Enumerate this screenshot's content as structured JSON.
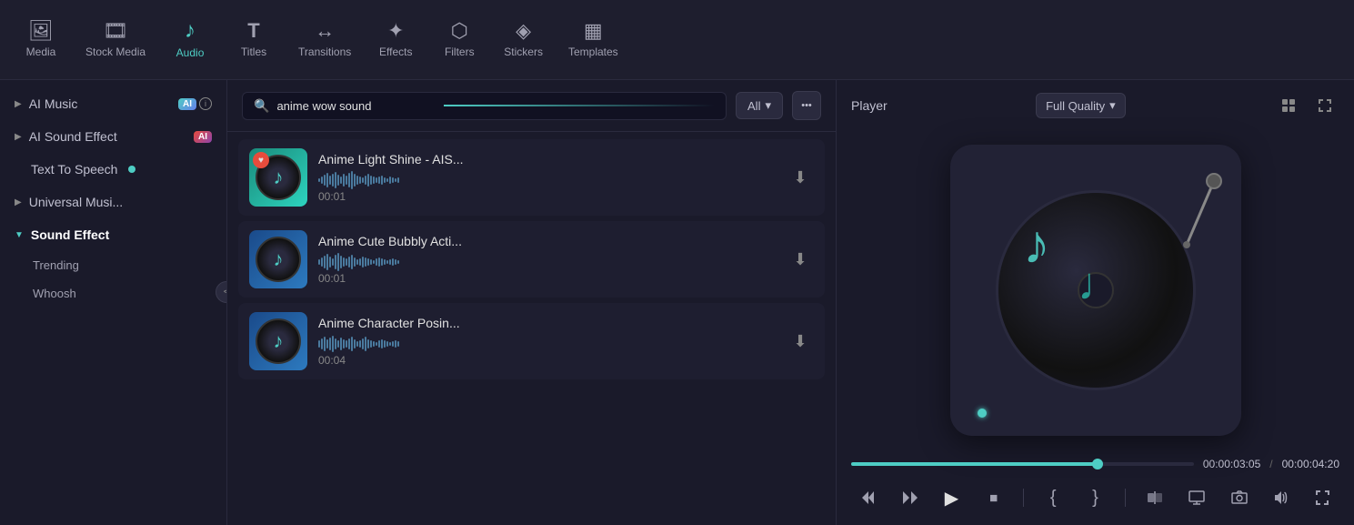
{
  "nav": {
    "items": [
      {
        "id": "media",
        "label": "Media",
        "icon": "🖼",
        "active": false
      },
      {
        "id": "stock-media",
        "label": "Stock Media",
        "icon": "🎞",
        "active": false
      },
      {
        "id": "audio",
        "label": "Audio",
        "icon": "♪",
        "active": true
      },
      {
        "id": "titles",
        "label": "Titles",
        "icon": "T",
        "active": false
      },
      {
        "id": "transitions",
        "label": "Transitions",
        "icon": "↔",
        "active": false
      },
      {
        "id": "effects",
        "label": "Effects",
        "icon": "✦",
        "active": false
      },
      {
        "id": "filters",
        "label": "Filters",
        "icon": "⬡",
        "active": false
      },
      {
        "id": "stickers",
        "label": "Stickers",
        "icon": "◈",
        "active": false
      },
      {
        "id": "templates",
        "label": "Templates",
        "icon": "▦",
        "active": false
      }
    ]
  },
  "sidebar": {
    "items": [
      {
        "id": "ai-music",
        "label": "AI Music",
        "type": "ai",
        "collapsed": true
      },
      {
        "id": "ai-sound-effect",
        "label": "AI Sound Effect",
        "type": "ai",
        "collapsed": true
      },
      {
        "id": "text-to-speech",
        "label": "Text To Speech",
        "type": "dot",
        "collapsed": false
      },
      {
        "id": "universal-music",
        "label": "Universal Musi...",
        "type": "arrow",
        "collapsed": true
      },
      {
        "id": "sound-effect",
        "label": "Sound Effect",
        "type": "expand",
        "collapsed": false
      }
    ],
    "sub_items": [
      {
        "id": "trending",
        "label": "Trending"
      },
      {
        "id": "whoosh",
        "label": "Whoosh"
      }
    ],
    "collapse_btn": "<"
  },
  "search": {
    "placeholder": "anime wow sound",
    "value": "anime wow sound",
    "filter_label": "All",
    "filter_icon": "▾",
    "more_icon": "•••"
  },
  "tracks": [
    {
      "id": "track-1",
      "title": "Anime Light Shine - AIS...",
      "duration": "00:01",
      "has_heart": true,
      "thumb_type": "green"
    },
    {
      "id": "track-2",
      "title": "Anime Cute Bubbly Acti...",
      "duration": "00:01",
      "has_heart": false,
      "thumb_type": "blue"
    },
    {
      "id": "track-3",
      "title": "Anime Character Posin...",
      "duration": "00:04",
      "has_heart": false,
      "thumb_type": "blue"
    }
  ],
  "player": {
    "label": "Player",
    "quality_label": "Full Quality",
    "time_current": "00:00:03:05",
    "time_separator": "/",
    "time_total": "00:00:04:20",
    "progress_percent": 72,
    "controls": [
      {
        "id": "rewind",
        "icon": "⏮",
        "label": "rewind"
      },
      {
        "id": "step-back",
        "icon": "⏭",
        "label": "step-back"
      },
      {
        "id": "play",
        "icon": "▶",
        "label": "play"
      },
      {
        "id": "stop",
        "icon": "⏹",
        "label": "stop"
      },
      {
        "id": "bracket-left",
        "icon": "[",
        "label": "bracket-left"
      },
      {
        "id": "bracket-right",
        "icon": "]",
        "label": "bracket-right"
      },
      {
        "id": "split",
        "icon": "⬕",
        "label": "split"
      },
      {
        "id": "monitor",
        "icon": "🖥",
        "label": "monitor"
      },
      {
        "id": "camera",
        "icon": "📷",
        "label": "camera"
      },
      {
        "id": "volume",
        "icon": "🔊",
        "label": "volume"
      },
      {
        "id": "fullscreen",
        "icon": "⛶",
        "label": "fullscreen"
      }
    ]
  },
  "colors": {
    "accent": "#4ecdc4",
    "bg_dark": "#1a1a2a",
    "bg_card": "#1e1e30",
    "border": "#2a2a3e",
    "text_primary": "#e0e0e0",
    "text_secondary": "#a0a0b0"
  }
}
